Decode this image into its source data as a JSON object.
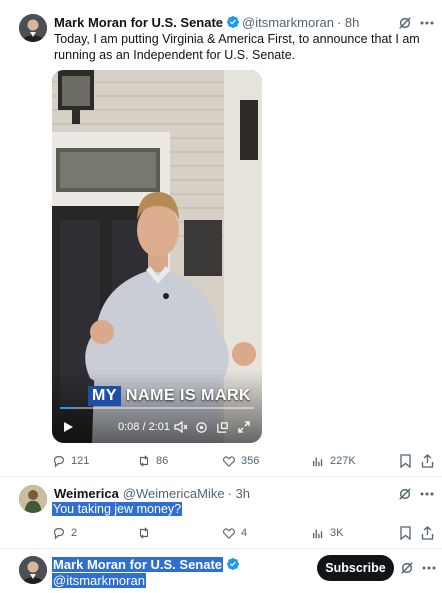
{
  "tweet": {
    "author_name": "Mark Moran for U.S. Senate",
    "author_handle": "@itsmarkmoran",
    "time": "· 8h",
    "text": "Today, I am putting Virginia & America First, to announce that I am running as an Independent for U.S. Senate.",
    "video": {
      "caption_highlight": "MY",
      "caption_rest": "NAME IS MARK",
      "time_display": "0:08 / 2:01",
      "progress": 0.066
    },
    "actions": {
      "replies": "121",
      "reposts": "86",
      "likes": "356",
      "views": "227K"
    }
  },
  "reply": {
    "author_name": "Weimerica",
    "author_handle": "@WeimericaMike",
    "time": "· 3h",
    "text": "You taking jew money?",
    "actions": {
      "replies": "2",
      "reposts": "",
      "likes": "4",
      "views": "3K"
    }
  },
  "profile_card": {
    "name": "Mark Moran for U.S. Senate",
    "handle": "@itsmarkmoran",
    "subscribe_label": "Subscribe"
  },
  "colors": {
    "verified_blue": "#1d9bf0",
    "text_primary": "#0f1419",
    "text_secondary": "#536471",
    "selection_highlight": "#2f6fd1",
    "caption_box": "#1d4ea8"
  },
  "icons": [
    "grok-icon",
    "more-icon",
    "reply-icon",
    "repost-icon",
    "like-icon",
    "views-icon",
    "bookmark-icon",
    "share-icon",
    "play-icon",
    "volume-icon",
    "settings-icon",
    "fullscreen-icon",
    "verified-badge-icon"
  ]
}
